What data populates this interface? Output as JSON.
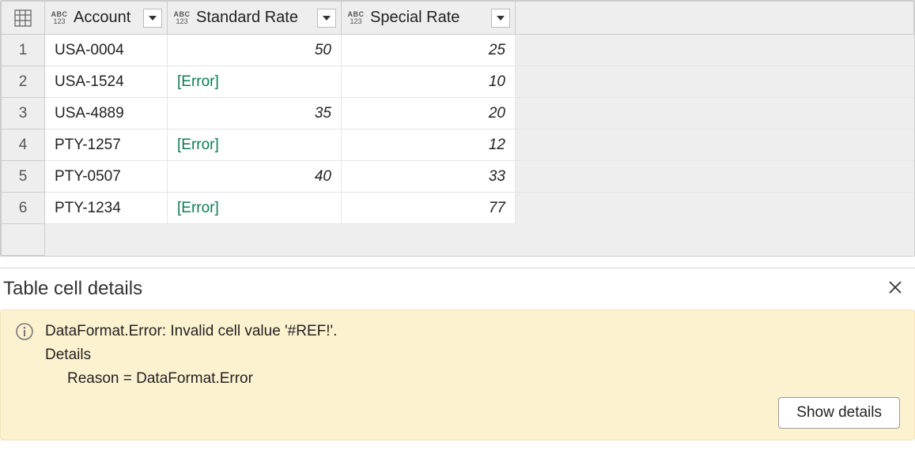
{
  "columns": [
    {
      "name": "Account",
      "type_top": "ABC",
      "type_bot": "123"
    },
    {
      "name": "Standard Rate",
      "type_top": "ABC",
      "type_bot": "123"
    },
    {
      "name": "Special Rate",
      "type_top": "ABC",
      "type_bot": "123"
    }
  ],
  "rows": [
    {
      "n": "1",
      "account": "USA-0004",
      "standard": "50",
      "special": "25",
      "std_error": false
    },
    {
      "n": "2",
      "account": "USA-1524",
      "standard": "[Error]",
      "special": "10",
      "std_error": true
    },
    {
      "n": "3",
      "account": "USA-4889",
      "standard": "35",
      "special": "20",
      "std_error": false
    },
    {
      "n": "4",
      "account": "PTY-1257",
      "standard": "[Error]",
      "special": "12",
      "std_error": true,
      "selected": true
    },
    {
      "n": "5",
      "account": "PTY-0507",
      "standard": "40",
      "special": "33",
      "std_error": false
    },
    {
      "n": "6",
      "account": "PTY-1234",
      "standard": "[Error]",
      "special": "77",
      "std_error": true
    }
  ],
  "details": {
    "title": "Table cell details",
    "message": "DataFormat.Error: Invalid cell value '#REF!'.",
    "details_label": "Details",
    "reason": "Reason = DataFormat.Error",
    "show_details_label": "Show details"
  }
}
